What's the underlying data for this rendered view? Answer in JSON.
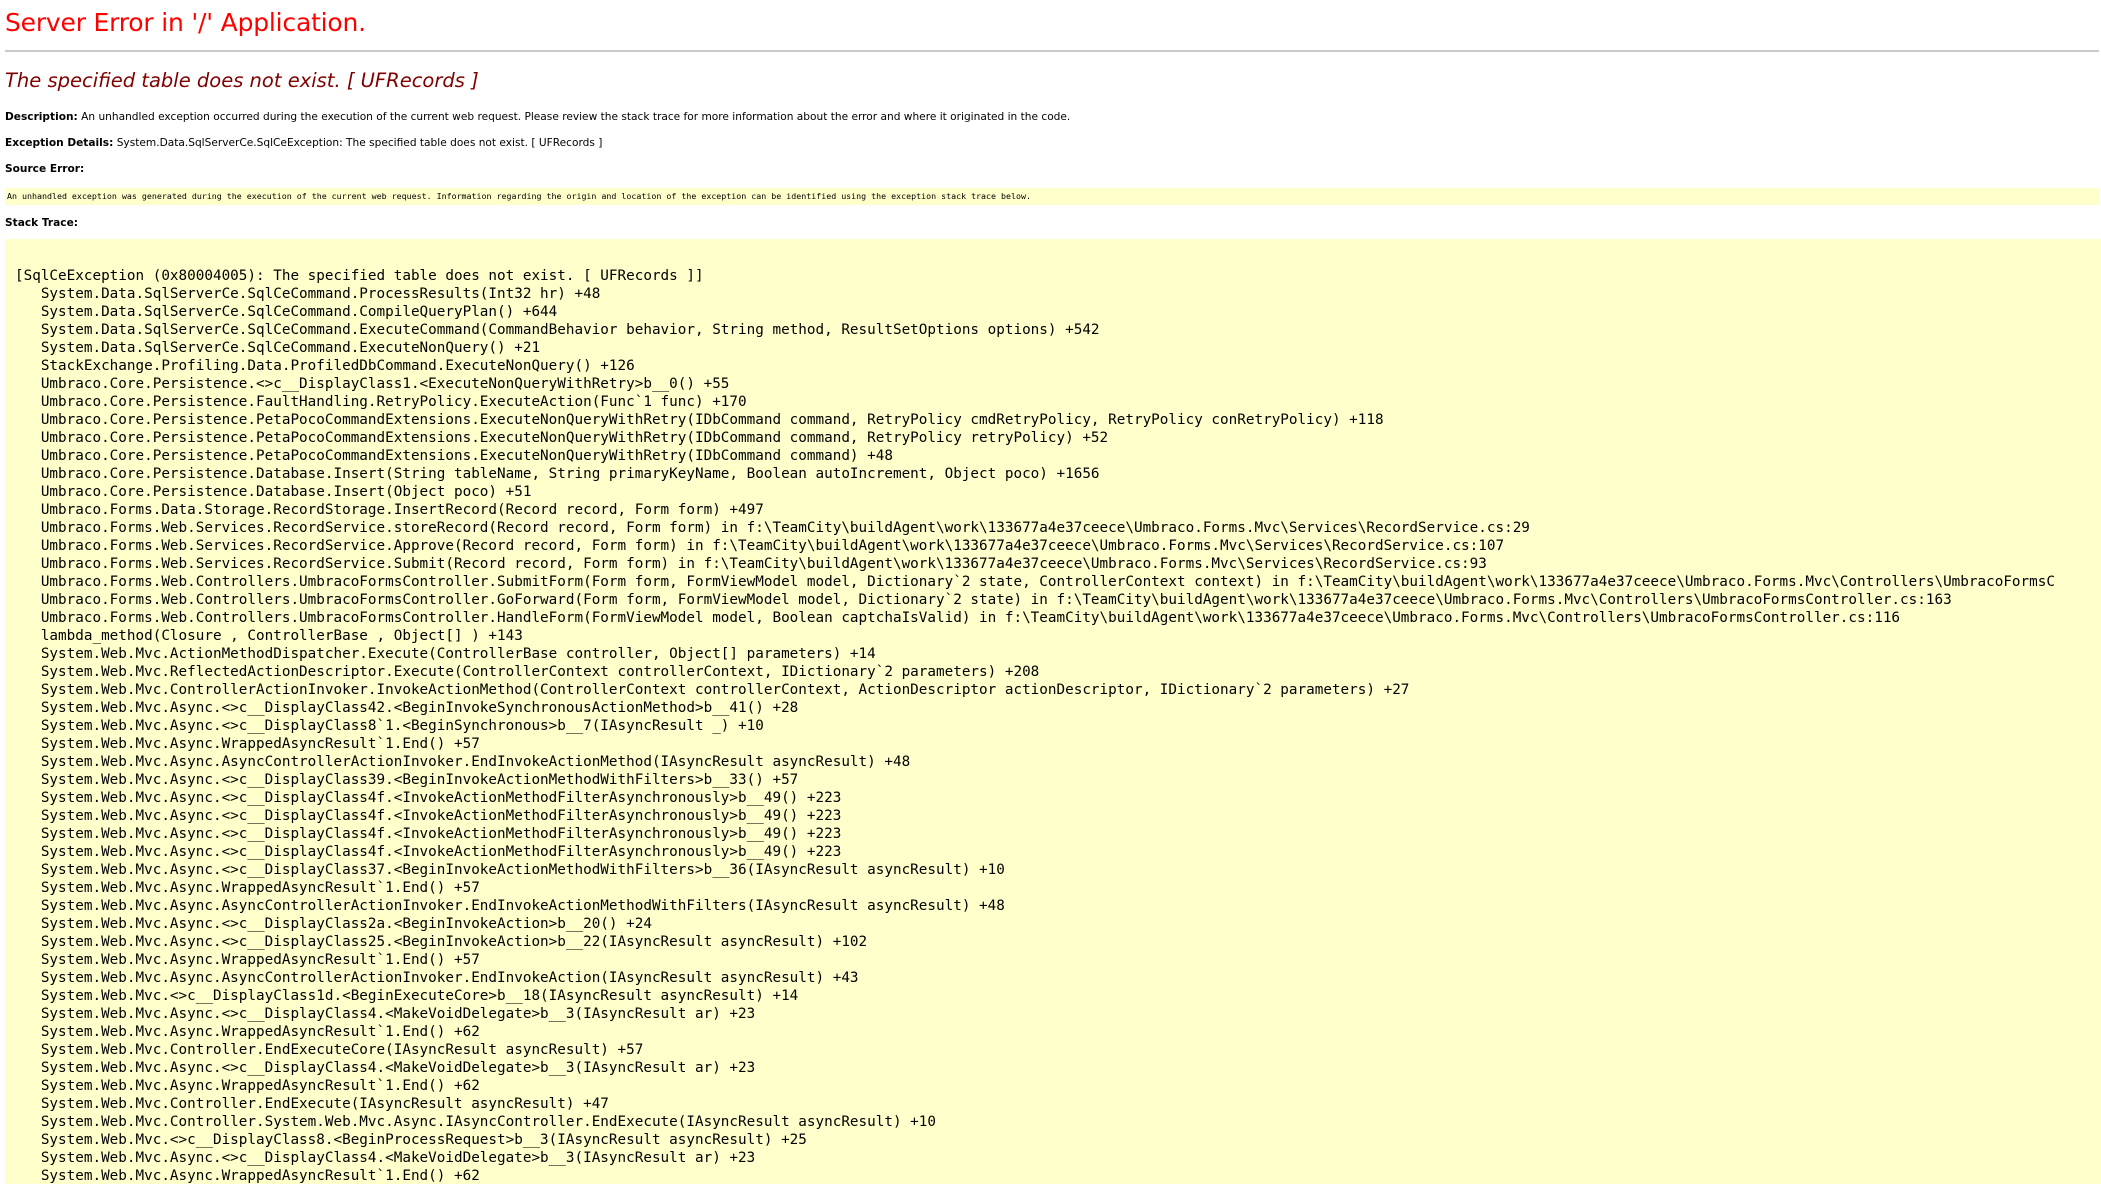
{
  "page": {
    "title": "Server Error in '/' Application.",
    "subtitle": "The specified table does not exist. [ UFRecords ]",
    "description_label": "Description:",
    "description_text": " An unhandled exception occurred during the execution of the current web request. Please review the stack trace for more information about the error and where it originated in the code.",
    "exception_label": "Exception Details:",
    "exception_text": " System.Data.SqlServerCe.SqlCeException: The specified table does not exist. [ UFRecords ]",
    "source_error_label": "Source Error:",
    "source_error_text": "An unhandled exception was generated during the execution of the current web request. Information regarding the origin and location of the exception can be identified using the exception stack trace below.",
    "stack_trace_label": "Stack Trace:"
  },
  "colors": {
    "title": "#ff0000",
    "subtitle": "#800000",
    "code_background": "#ffffcc",
    "rule": "#c8c8c8"
  },
  "stack_trace": [
    "[SqlCeException (0x80004005): The specified table does not exist. [ UFRecords ]]",
    "   System.Data.SqlServerCe.SqlCeCommand.ProcessResults(Int32 hr) +48",
    "   System.Data.SqlServerCe.SqlCeCommand.CompileQueryPlan() +644",
    "   System.Data.SqlServerCe.SqlCeCommand.ExecuteCommand(CommandBehavior behavior, String method, ResultSetOptions options) +542",
    "   System.Data.SqlServerCe.SqlCeCommand.ExecuteNonQuery() +21",
    "   StackExchange.Profiling.Data.ProfiledDbCommand.ExecuteNonQuery() +126",
    "   Umbraco.Core.Persistence.<>c__DisplayClass1.<ExecuteNonQueryWithRetry>b__0() +55",
    "   Umbraco.Core.Persistence.FaultHandling.RetryPolicy.ExecuteAction(Func`1 func) +170",
    "   Umbraco.Core.Persistence.PetaPocoCommandExtensions.ExecuteNonQueryWithRetry(IDbCommand command, RetryPolicy cmdRetryPolicy, RetryPolicy conRetryPolicy) +118",
    "   Umbraco.Core.Persistence.PetaPocoCommandExtensions.ExecuteNonQueryWithRetry(IDbCommand command, RetryPolicy retryPolicy) +52",
    "   Umbraco.Core.Persistence.PetaPocoCommandExtensions.ExecuteNonQueryWithRetry(IDbCommand command) +48",
    "   Umbraco.Core.Persistence.Database.Insert(String tableName, String primaryKeyName, Boolean autoIncrement, Object poco) +1656",
    "   Umbraco.Core.Persistence.Database.Insert(Object poco) +51",
    "   Umbraco.Forms.Data.Storage.RecordStorage.InsertRecord(Record record, Form form) +497",
    "   Umbraco.Forms.Web.Services.RecordService.storeRecord(Record record, Form form) in f:\\TeamCity\\buildAgent\\work\\133677a4e37ceece\\Umbraco.Forms.Mvc\\Services\\RecordService.cs:29",
    "   Umbraco.Forms.Web.Services.RecordService.Approve(Record record, Form form) in f:\\TeamCity\\buildAgent\\work\\133677a4e37ceece\\Umbraco.Forms.Mvc\\Services\\RecordService.cs:107",
    "   Umbraco.Forms.Web.Services.RecordService.Submit(Record record, Form form) in f:\\TeamCity\\buildAgent\\work\\133677a4e37ceece\\Umbraco.Forms.Mvc\\Services\\RecordService.cs:93",
    "   Umbraco.Forms.Web.Controllers.UmbracoFormsController.SubmitForm(Form form, FormViewModel model, Dictionary`2 state, ControllerContext context) in f:\\TeamCity\\buildAgent\\work\\133677a4e37ceece\\Umbraco.Forms.Mvc\\Controllers\\UmbracoFormsC",
    "   Umbraco.Forms.Web.Controllers.UmbracoFormsController.GoForward(Form form, FormViewModel model, Dictionary`2 state) in f:\\TeamCity\\buildAgent\\work\\133677a4e37ceece\\Umbraco.Forms.Mvc\\Controllers\\UmbracoFormsController.cs:163",
    "   Umbraco.Forms.Web.Controllers.UmbracoFormsController.HandleForm(FormViewModel model, Boolean captchaIsValid) in f:\\TeamCity\\buildAgent\\work\\133677a4e37ceece\\Umbraco.Forms.Mvc\\Controllers\\UmbracoFormsController.cs:116",
    "   lambda_method(Closure , ControllerBase , Object[] ) +143",
    "   System.Web.Mvc.ActionMethodDispatcher.Execute(ControllerBase controller, Object[] parameters) +14",
    "   System.Web.Mvc.ReflectedActionDescriptor.Execute(ControllerContext controllerContext, IDictionary`2 parameters) +208",
    "   System.Web.Mvc.ControllerActionInvoker.InvokeActionMethod(ControllerContext controllerContext, ActionDescriptor actionDescriptor, IDictionary`2 parameters) +27",
    "   System.Web.Mvc.Async.<>c__DisplayClass42.<BeginInvokeSynchronousActionMethod>b__41() +28",
    "   System.Web.Mvc.Async.<>c__DisplayClass8`1.<BeginSynchronous>b__7(IAsyncResult _) +10",
    "   System.Web.Mvc.Async.WrappedAsyncResult`1.End() +57",
    "   System.Web.Mvc.Async.AsyncControllerActionInvoker.EndInvokeActionMethod(IAsyncResult asyncResult) +48",
    "   System.Web.Mvc.Async.<>c__DisplayClass39.<BeginInvokeActionMethodWithFilters>b__33() +57",
    "   System.Web.Mvc.Async.<>c__DisplayClass4f.<InvokeActionMethodFilterAsynchronously>b__49() +223",
    "   System.Web.Mvc.Async.<>c__DisplayClass4f.<InvokeActionMethodFilterAsynchronously>b__49() +223",
    "   System.Web.Mvc.Async.<>c__DisplayClass4f.<InvokeActionMethodFilterAsynchronously>b__49() +223",
    "   System.Web.Mvc.Async.<>c__DisplayClass4f.<InvokeActionMethodFilterAsynchronously>b__49() +223",
    "   System.Web.Mvc.Async.<>c__DisplayClass37.<BeginInvokeActionMethodWithFilters>b__36(IAsyncResult asyncResult) +10",
    "   System.Web.Mvc.Async.WrappedAsyncResult`1.End() +57",
    "   System.Web.Mvc.Async.AsyncControllerActionInvoker.EndInvokeActionMethodWithFilters(IAsyncResult asyncResult) +48",
    "   System.Web.Mvc.Async.<>c__DisplayClass2a.<BeginInvokeAction>b__20() +24",
    "   System.Web.Mvc.Async.<>c__DisplayClass25.<BeginInvokeAction>b__22(IAsyncResult asyncResult) +102",
    "   System.Web.Mvc.Async.WrappedAsyncResult`1.End() +57",
    "   System.Web.Mvc.Async.AsyncControllerActionInvoker.EndInvokeAction(IAsyncResult asyncResult) +43",
    "   System.Web.Mvc.<>c__DisplayClass1d.<BeginExecuteCore>b__18(IAsyncResult asyncResult) +14",
    "   System.Web.Mvc.Async.<>c__DisplayClass4.<MakeVoidDelegate>b__3(IAsyncResult ar) +23",
    "   System.Web.Mvc.Async.WrappedAsyncResult`1.End() +62",
    "   System.Web.Mvc.Controller.EndExecuteCore(IAsyncResult asyncResult) +57",
    "   System.Web.Mvc.Async.<>c__DisplayClass4.<MakeVoidDelegate>b__3(IAsyncResult ar) +23",
    "   System.Web.Mvc.Async.WrappedAsyncResult`1.End() +62",
    "   System.Web.Mvc.Controller.EndExecute(IAsyncResult asyncResult) +47",
    "   System.Web.Mvc.Controller.System.Web.Mvc.Async.IAsyncController.EndExecute(IAsyncResult asyncResult) +10",
    "   System.Web.Mvc.<>c__DisplayClass8.<BeginProcessRequest>b__3(IAsyncResult asyncResult) +25",
    "   System.Web.Mvc.Async.<>c__DisplayClass4.<MakeVoidDelegate>b__3(IAsyncResult ar) +23",
    "   System.Web.Mvc.Async.WrappedAsyncResult`1.End() +62"
  ]
}
